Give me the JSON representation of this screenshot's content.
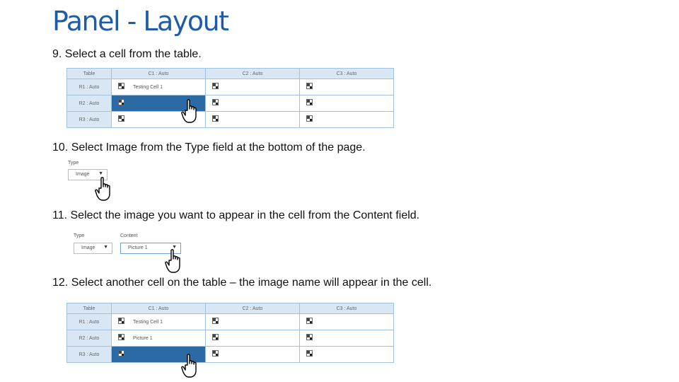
{
  "title": "Panel - Layout",
  "steps": {
    "s9": "9. Select a cell from the table.",
    "s10": "10. Select Image from the Type field at the bottom of the page.",
    "s11": "11. Select the image you want to appear in the cell from the Content field.",
    "s12": "12. Select another cell on the table – the image name will appear in the cell."
  },
  "table1": {
    "headers": [
      "Table",
      "C1 : Auto",
      "C2 : Auto",
      "C3 : Auto"
    ],
    "rows": [
      "R1 : Auto",
      "R2 : Auto",
      "R3 : Auto"
    ],
    "r1c1": "Testing Cell 1"
  },
  "type_field": {
    "label": "Type",
    "value": "Image"
  },
  "content_field": {
    "type_label": "Type",
    "type_value": "Image",
    "label": "Content",
    "value": "Picture 1"
  },
  "table2": {
    "headers": [
      "Table",
      "C1 : Auto",
      "C2 : Auto",
      "C3 : Auto"
    ],
    "rows": [
      "R1 : Auto",
      "R2 : Auto",
      "R3 : Auto"
    ],
    "r1c1": "Testing Cell 1",
    "r2c1": "Picture 1"
  },
  "colors": {
    "title": "#1f5ca8",
    "selected_cell": "#2c6aa6",
    "header_bg": "#d9e7f5"
  }
}
